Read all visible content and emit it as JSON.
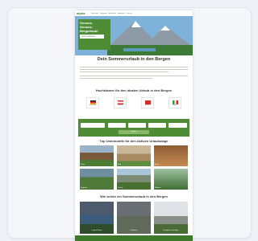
{
  "site": {
    "logo": "alpha",
    "menu": [
      "Unterkunft",
      "Regionen",
      "Aktivitäten",
      "Angebote",
      "Kontakt"
    ]
  },
  "hero": {
    "title_lines": [
      "Genuss,",
      "Genuss,",
      "Bergurlaub!"
    ],
    "button_label": "Jetzt entdecken"
  },
  "intro_heading": "Dein Sommerurlaub in den Bergen",
  "countries_heading": "Hochhäuser für den idealen Urlaub in den Bergen",
  "countries": [
    {
      "name": "Deutschland",
      "color": "#222222"
    },
    {
      "name": "Österreich",
      "color": "#d92b2b"
    },
    {
      "name": "Schweiz",
      "color": "#d92b2b"
    },
    {
      "name": "Italien",
      "color": "#2e9e45"
    }
  ],
  "search": {
    "button_label": "Suchen"
  },
  "section_heading": "Top Unterkünfte für den Aktiven Urlaubstage",
  "tiles": [
    "Chalet",
    "Hotel",
    "Sauna",
    "Berghütte",
    "Pension",
    "Wellness"
  ],
  "gallery_heading": "Wie schön ein Sommerurlaub in den Bergen",
  "gallery": [
    "Lago di Braies",
    "Dolomiten",
    "Bergdorf in den Alpen"
  ],
  "colors": {
    "brand": "#4f8c36",
    "dark": "#3f7a2c"
  }
}
